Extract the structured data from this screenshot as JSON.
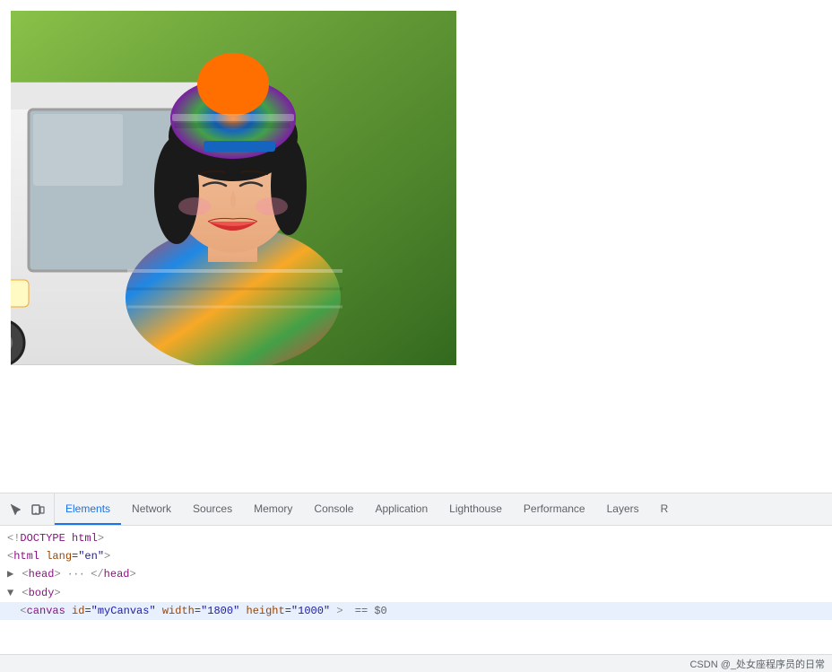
{
  "page": {
    "background_color": "#ffffff"
  },
  "devtools": {
    "tabs": [
      {
        "id": "elements",
        "label": "Elements",
        "active": true
      },
      {
        "id": "network",
        "label": "Network",
        "active": false
      },
      {
        "id": "sources",
        "label": "Sources",
        "active": false
      },
      {
        "id": "memory",
        "label": "Memory",
        "active": false
      },
      {
        "id": "console",
        "label": "Console",
        "active": false
      },
      {
        "id": "application",
        "label": "Application",
        "active": false
      },
      {
        "id": "lighthouse",
        "label": "Lighthouse",
        "active": false
      },
      {
        "id": "performance",
        "label": "Performance",
        "active": false
      },
      {
        "id": "layers",
        "label": "Layers",
        "active": false
      },
      {
        "id": "recorder",
        "label": "R",
        "active": false
      }
    ],
    "code_lines": [
      {
        "id": 1,
        "text": "<!DOCTYPE html>",
        "highlighted": false
      },
      {
        "id": 2,
        "text": "<html lang=\"en\">",
        "highlighted": false
      },
      {
        "id": 3,
        "text": "▶ <head> ··· </head>",
        "highlighted": false
      },
      {
        "id": 4,
        "text": "▼ <body>",
        "highlighted": false
      },
      {
        "id": 5,
        "text": "  <canvas id=\"myCanvas\" width=\"1800\" height=\"1000\"> == $0",
        "highlighted": true
      }
    ],
    "status_bar": {
      "text": "CSDN @_处女座程序员的日常"
    },
    "icon_cursor": "⬚",
    "icon_inspect": "⬡"
  }
}
